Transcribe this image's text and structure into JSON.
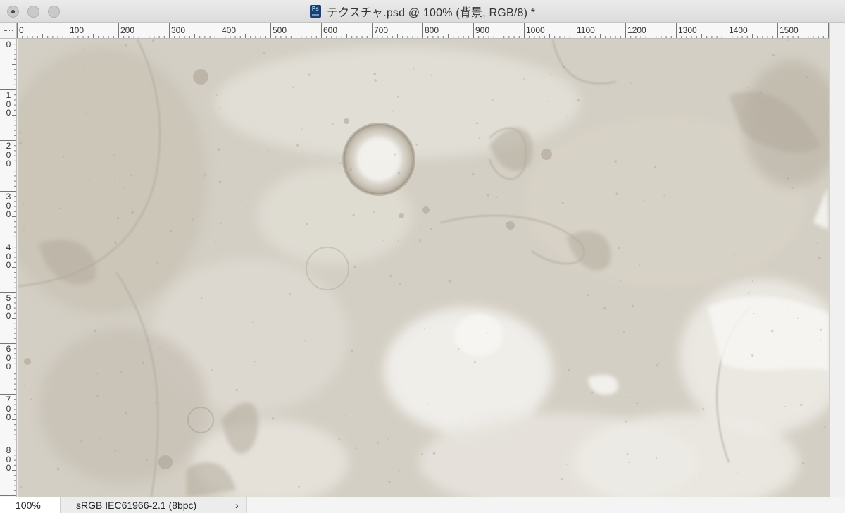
{
  "window": {
    "title": "テクスチャ.psd @ 100% (背景, RGB/8) *",
    "app_icon": "photoshop-document-icon",
    "app_icon_text": "Ps"
  },
  "rulers": {
    "horizontal": [
      "0",
      "100",
      "200",
      "300",
      "400",
      "500",
      "600",
      "700",
      "800",
      "900",
      "1000",
      "1100",
      "1200",
      "1300",
      "1400",
      "1500"
    ],
    "vertical": [
      "0",
      "100",
      "200",
      "300",
      "400",
      "500",
      "600",
      "700",
      "800"
    ]
  },
  "status": {
    "zoom": "100%",
    "color_profile": "sRGB IEC61966-2.1 (8bpc)",
    "chevron": "›"
  },
  "colors": {
    "canvas_base": "#d6d1c6",
    "stain_dark": "#a59d8f",
    "stain_light": "#f1efe9"
  }
}
